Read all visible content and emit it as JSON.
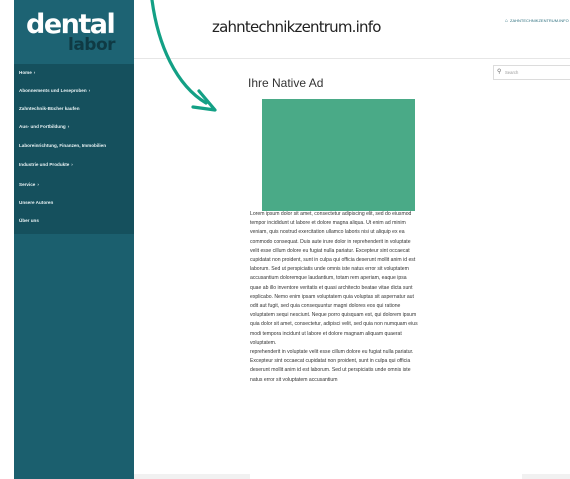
{
  "logo": {
    "main": "dental",
    "sub": "labor"
  },
  "menu": [
    {
      "label": "Home",
      "has_children": true
    },
    {
      "label": "Abonnements und Leseproben",
      "has_children": true
    },
    {
      "label": "Zahntechnik-Bücher kaufen",
      "has_children": false
    },
    {
      "label": "Aus- und Fortbildung",
      "has_children": true
    },
    {
      "label": "Laboreinrichtung, Finanzen, Immobilien",
      "has_children": false
    },
    {
      "label": "Industrie und Produkte",
      "has_children": true
    },
    {
      "label": "Service",
      "has_children": true
    },
    {
      "label": "Unsere Autoren",
      "has_children": false
    },
    {
      "label": "Über uns",
      "has_children": false
    }
  ],
  "header": {
    "site_title": "zahntechnikzentrum.info",
    "top_link": "ZAHNTECHNIKZENTRUM.INFO"
  },
  "search": {
    "placeholder": "Search"
  },
  "article": {
    "title": "Ihre Native Ad",
    "body": "Lorem ipsum dolor sit amet, consectetur adipiscing elit, sed do eiusmod tempor incididunt ut labore et dolore magna aliqua. Ut enim ad minim veniam, quis nostrud exercitation ullamco laboris nisi ut aliquip ex ea commodo consequat. Duis aute irure dolor in reprehenderit in voluptate velit esse cillum dolore eu fugiat nulla pariatur. Excepteur sint occaecat cupidatat non proident, sunt in culpa qui officia deserunt mollit anim id est laborum. Sed ut perspiciatis unde omnis iste natus error sit voluptatem accusantium doloremque laudantium, totam rem aperiam, eaque ipsa quae ab illo inventore veritatis et quasi architecto beatae vitae dicta sunt explicabo. Nemo enim ipsam voluptatem quia voluptas sit aspernatur aut odit aut fugit, sed quia consequuntur magni dolores eos qui ratione voluptatem sequi nesciunt. Neque porro quisquam est, qui dolorem ipsum quia dolor sit amet, consectetur, adipisci velit, sed quia non numquam eius modi tempora incidunt ut labore et dolore magnam aliquam quaerat voluptatem.",
    "body2": "reprehenderit in voluptate velit esse cillum dolore eu fugiat nulla pariatur. Excepteur sint occaecat cupidatat non proident, sunt in culpa qui officia deserunt mollit anim id est laborum. Sed ut perspiciatis unde omnis iste natus error sit voluptatem accusantium"
  },
  "colors": {
    "sidebar": "#1b5f6e",
    "ad_image": "#4aaa87",
    "arrow": "#13a085"
  },
  "icons": {
    "search": "search-icon",
    "home": "home-icon",
    "chevron": "chevron-right-icon"
  }
}
